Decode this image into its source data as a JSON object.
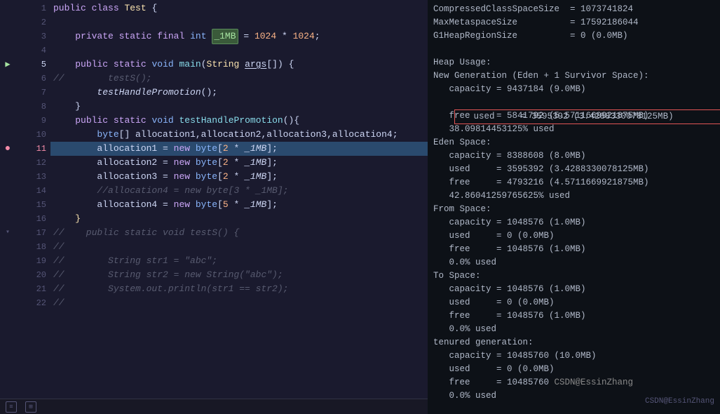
{
  "editor": {
    "lines": [
      {
        "num": "1",
        "gi": "none",
        "text": "public class Test {",
        "highlight": false
      },
      {
        "num": "2",
        "gi": "none",
        "text": "",
        "highlight": false
      },
      {
        "num": "3",
        "gi": "none",
        "text": "    private static final int _1MB = 1024 * 1024;",
        "highlight": false
      },
      {
        "num": "4",
        "gi": "none",
        "text": "",
        "highlight": false
      },
      {
        "num": "5",
        "gi": "run",
        "text": "    public static void main(String args[]) {",
        "highlight": false
      },
      {
        "num": "6",
        "gi": "none",
        "text": "//        testS();",
        "highlight": false
      },
      {
        "num": "7",
        "gi": "none",
        "text": "        testHandlePromotion();",
        "highlight": false
      },
      {
        "num": "8",
        "gi": "none",
        "text": "    }",
        "highlight": false
      },
      {
        "num": "9",
        "gi": "none",
        "text": "    public static void testHandlePromotion(){",
        "highlight": false
      },
      {
        "num": "10",
        "gi": "none",
        "text": "        byte[] allocation1,allocation2,allocation3,allocation4;",
        "highlight": false
      },
      {
        "num": "11",
        "gi": "bp",
        "text": "        allocation1 = new byte[2 * _1MB];",
        "highlight": true
      },
      {
        "num": "12",
        "gi": "none",
        "text": "        allocation2 = new byte[2 * _1MB];",
        "highlight": false
      },
      {
        "num": "13",
        "gi": "none",
        "text": "        allocation3 = new byte[2 * _1MB];",
        "highlight": false
      },
      {
        "num": "14",
        "gi": "none",
        "text": "        //allocation4 = new byte[3 * _1MB];",
        "highlight": false
      },
      {
        "num": "15",
        "gi": "none",
        "text": "        allocation4 = new byte[5 * _1MB];",
        "highlight": false
      },
      {
        "num": "16",
        "gi": "none",
        "text": "    }",
        "highlight": false
      },
      {
        "num": "17",
        "gi": "fold",
        "text": "//    public static void testS() {",
        "highlight": false
      },
      {
        "num": "18",
        "gi": "none",
        "text": "//",
        "highlight": false
      },
      {
        "num": "19",
        "gi": "none",
        "text": "//        String str1 = \"abc\";",
        "highlight": false
      },
      {
        "num": "20",
        "gi": "none",
        "text": "//        String str2 = new String(\"abc\");",
        "highlight": false
      },
      {
        "num": "21",
        "gi": "none",
        "text": "//        System.out.println(str1 == str2);",
        "highlight": false
      },
      {
        "num": "22",
        "gi": "none",
        "text": "//",
        "highlight": false
      }
    ]
  },
  "console": {
    "lines": [
      "CompressedClassSpaceSize  = 1073741824",
      "MaxMetaspaceSize          = 17592186044",
      "G1HeapRegionSize          = 0 (0.0MB)",
      "",
      "Heap Usage:",
      "New Generation (Eden + 1 Survivor Space):",
      "   capacity = 9437184 (9.0MB)",
      "   used     = 3595392 (3.4288330078125MB)",
      "   free     = 5841792 (5.571166992187 5MB)",
      "   38.09814453125% used",
      "Eden Space:",
      "   capacity = 8388608 (8.0MB)",
      "   used     = 3595392 (3.4288330078125MB)",
      "   free     = 4793216 (4.5711669921875MB)",
      "   42.860412597656 25% used",
      "From Space:",
      "   capacity = 1048576 (1.0MB)",
      "   used     = 0 (0.0MB)",
      "   free     = 1048576 (1.0MB)",
      "   0.0% used",
      "To Space:",
      "   capacity = 1048576 (1.0MB)",
      "   used     = 0 (0.0MB)",
      "   free     = 1048576 (1.0MB)",
      "   0.0% used",
      "tenured generation:",
      "   capacity = 10485760 (10.0MB)",
      "   used     = 0 (0.0MB)",
      "   free     = 10485760 (CSDN@EssinZhang",
      "   0.0% used"
    ],
    "highlighted_line": 7,
    "watermark": "CSDN@EssinZhang"
  },
  "statusbar": {
    "icon1": "≡",
    "icon2": "⊞"
  }
}
